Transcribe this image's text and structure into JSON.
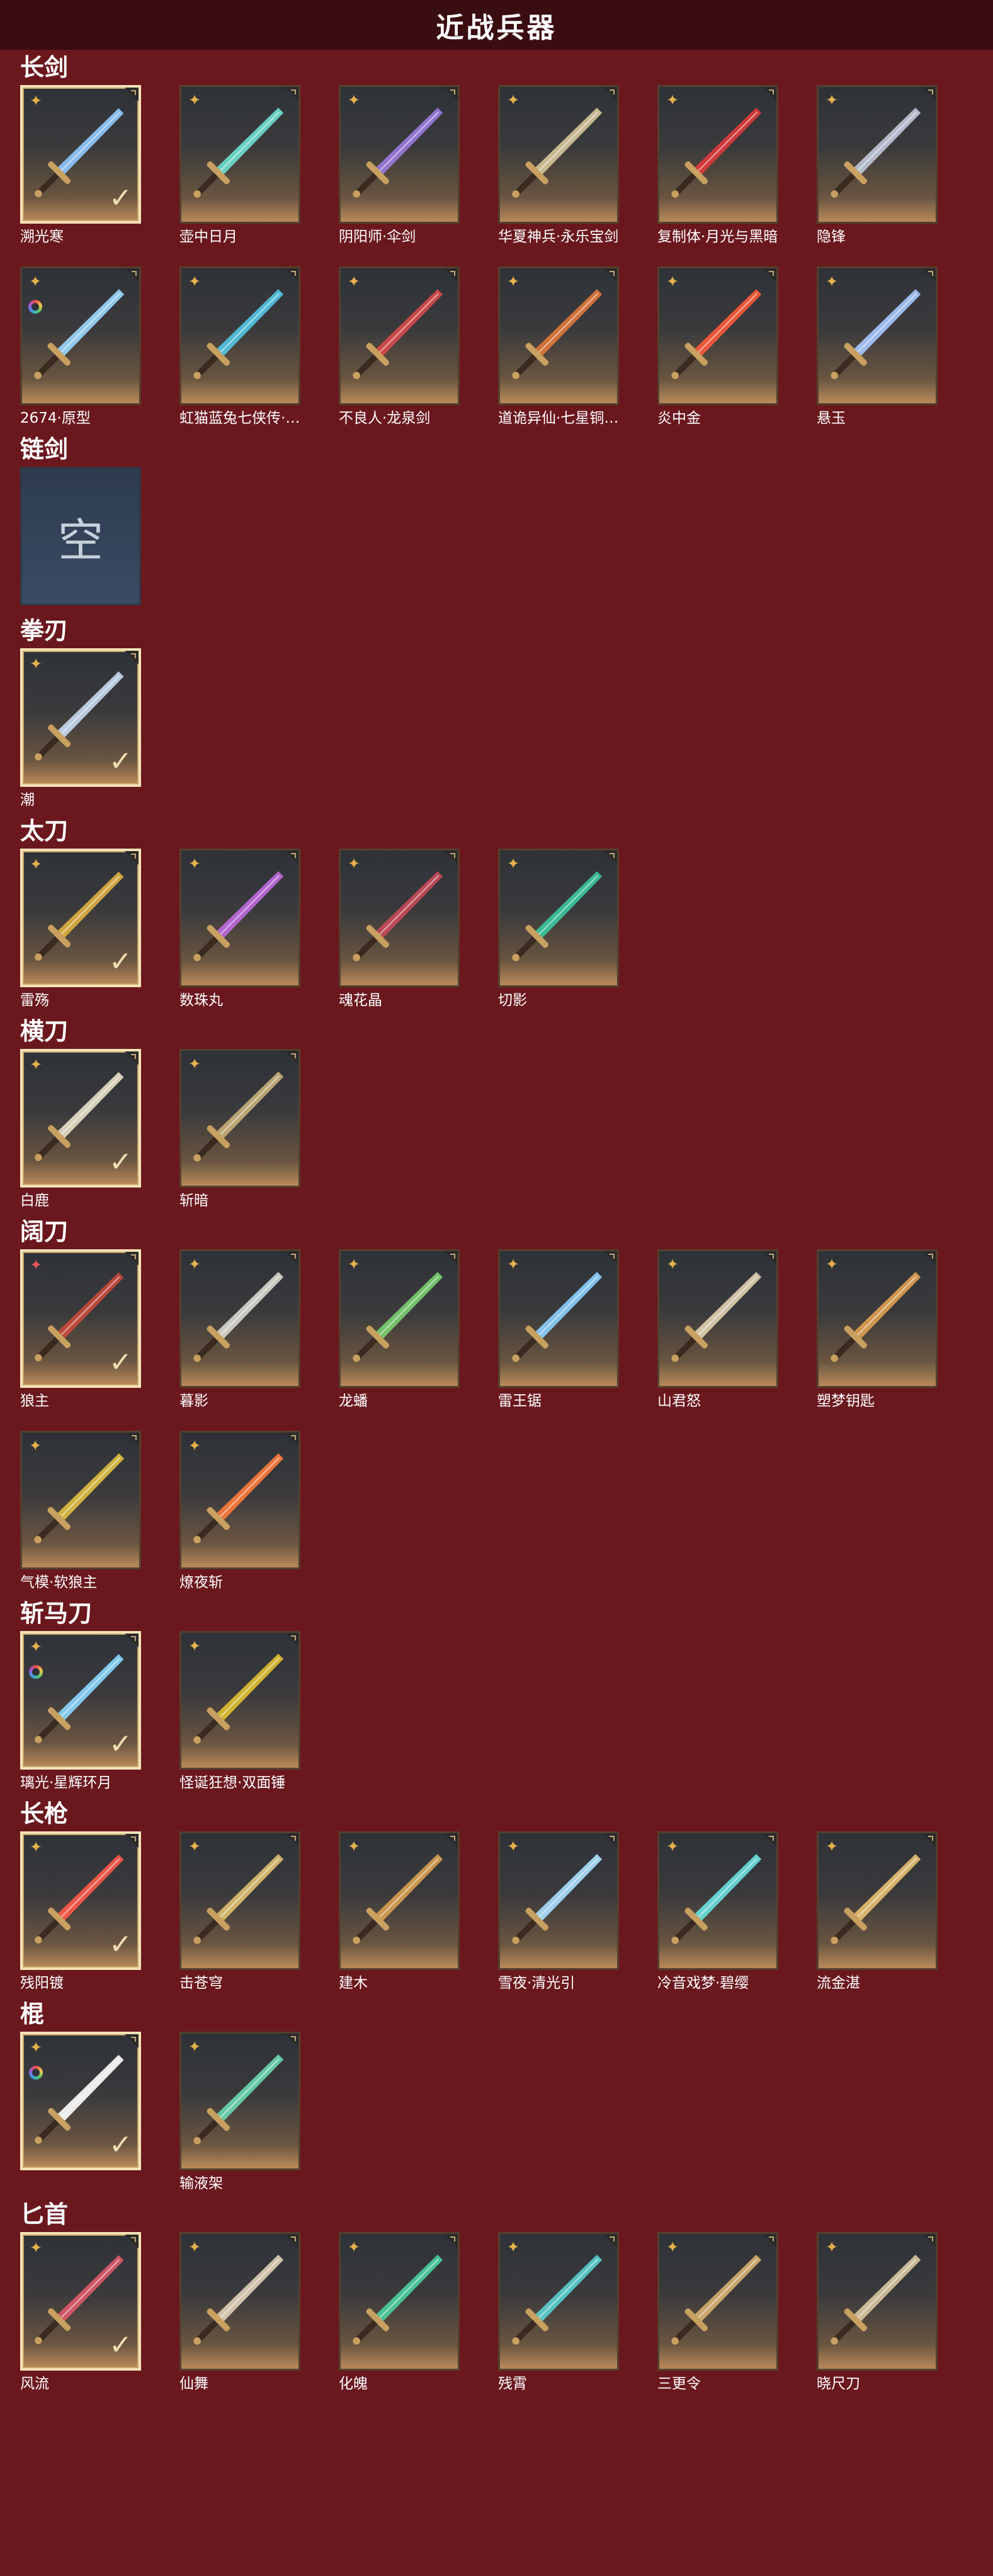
{
  "header": {
    "title": "近战兵器"
  },
  "colors": {
    "background": "#6a181e",
    "header": "#3a0d11",
    "selected_border": "#f4e3b8",
    "rarity_gold": "#e5b14a"
  },
  "sections": [
    {
      "id": "changjian",
      "title": "长剑",
      "items": [
        {
          "name": "溯光寒",
          "rarity": "gold",
          "selected": true,
          "color": "#8fc9ff"
        },
        {
          "name": "壶中日月",
          "rarity": "gold",
          "selected": false,
          "color": "#6ee0d0"
        },
        {
          "name": "阴阳师·伞剑",
          "rarity": "gold",
          "selected": false,
          "color": "#9c7be0"
        },
        {
          "name": "华夏神兵·永乐宝剑",
          "rarity": "gold",
          "selected": false,
          "color": "#d7c69a"
        },
        {
          "name": "复制体·月光与黑暗",
          "rarity": "gold",
          "selected": false,
          "color": "#e03a3a"
        },
        {
          "name": "隐锋",
          "rarity": "gold",
          "selected": false,
          "color": "#c0c8d8"
        },
        {
          "name": "2674·原型",
          "rarity": "rainbow",
          "selected": false,
          "color": "#9ad8ff"
        },
        {
          "name": "虹猫蓝兔七侠传·冰魄剑",
          "rarity": "gold",
          "selected": false,
          "color": "#52c6e6"
        },
        {
          "name": "不良人·龙泉剑",
          "rarity": "gold",
          "selected": false,
          "color": "#d84a4a"
        },
        {
          "name": "道诡异仙·七星铜钱剑",
          "rarity": "gold",
          "selected": false,
          "color": "#e0783a"
        },
        {
          "name": "炎中金",
          "rarity": "gold",
          "selected": false,
          "color": "#ff5a3a"
        },
        {
          "name": "悬玉",
          "rarity": "gold",
          "selected": false,
          "color": "#a8c8ff"
        }
      ]
    },
    {
      "id": "lianjian",
      "title": "链剑",
      "items": [
        {
          "name": "",
          "rarity": "none",
          "selected": false,
          "empty": true,
          "empty_text": "空"
        }
      ]
    },
    {
      "id": "quanren",
      "title": "拳刃",
      "items": [
        {
          "name": "潮",
          "rarity": "gold",
          "selected": true,
          "color": "#c8d8f0"
        }
      ]
    },
    {
      "id": "taidao",
      "title": "太刀",
      "items": [
        {
          "name": "雷殇",
          "rarity": "gold",
          "selected": true,
          "color": "#e0b040"
        },
        {
          "name": "数珠丸",
          "rarity": "gold",
          "selected": false,
          "color": "#c06ae0"
        },
        {
          "name": "魂花晶",
          "rarity": "gold",
          "selected": false,
          "color": "#c84a5a"
        },
        {
          "name": "切影",
          "rarity": "gold",
          "selected": false,
          "color": "#3ac8a0"
        }
      ]
    },
    {
      "id": "hengdao",
      "title": "横刀",
      "items": [
        {
          "name": "白鹿",
          "rarity": "gold",
          "selected": true,
          "color": "#e8e0c8"
        },
        {
          "name": "斩暗",
          "rarity": "gold",
          "selected": false,
          "color": "#c8b07a"
        }
      ]
    },
    {
      "id": "kuodao",
      "title": "阔刀",
      "items": [
        {
          "name": "狼主",
          "rarity": "red",
          "selected": true,
          "color": "#c84a3a"
        },
        {
          "name": "暮影",
          "rarity": "gold",
          "selected": false,
          "color": "#d8d8d0"
        },
        {
          "name": "龙蟠",
          "rarity": "gold",
          "selected": false,
          "color": "#7ad070"
        },
        {
          "name": "雷王锯",
          "rarity": "gold",
          "selected": false,
          "color": "#8ad0ff"
        },
        {
          "name": "山君怒",
          "rarity": "gold",
          "selected": false,
          "color": "#e0d0b0"
        },
        {
          "name": "塑梦钥匙",
          "rarity": "gold",
          "selected": false,
          "color": "#e0a050"
        },
        {
          "name": "气模·软狼主",
          "rarity": "gold",
          "selected": false,
          "color": "#e0c040"
        },
        {
          "name": "燎夜斩",
          "rarity": "gold",
          "selected": false,
          "color": "#ff7a3a"
        }
      ]
    },
    {
      "id": "zhanmadao",
      "title": "斩马刀",
      "items": [
        {
          "name": "璃光·星辉环月",
          "rarity": "rainbow",
          "selected": true,
          "color": "#8ad8ff"
        },
        {
          "name": "怪诞狂想·双面锤",
          "rarity": "gold",
          "selected": false,
          "color": "#e0c030"
        }
      ]
    },
    {
      "id": "changqiang",
      "title": "长枪",
      "items": [
        {
          "name": "残阳镀",
          "rarity": "gold",
          "selected": true,
          "color": "#ff5a4a"
        },
        {
          "name": "击苍穹",
          "rarity": "gold",
          "selected": false,
          "color": "#e0c070"
        },
        {
          "name": "建木",
          "rarity": "gold",
          "selected": false,
          "color": "#d8a050"
        },
        {
          "name": "雪夜·清光引",
          "rarity": "gold",
          "selected": false,
          "color": "#a8e0ff"
        },
        {
          "name": "冷音戏梦·碧缨",
          "rarity": "gold",
          "selected": false,
          "color": "#6ae0e0"
        },
        {
          "name": "流金湛",
          "rarity": "gold",
          "selected": false,
          "color": "#e8c070"
        }
      ]
    },
    {
      "id": "gun",
      "title": "棍",
      "items": [
        {
          "name": "",
          "rarity": "rainbow",
          "selected": true,
          "color": "#ffffff"
        },
        {
          "name": "输液架",
          "rarity": "gold",
          "selected": false,
          "color": "#6ad8b0"
        }
      ]
    },
    {
      "id": "bishou",
      "title": "匕首",
      "items": [
        {
          "name": "风流",
          "rarity": "gold",
          "selected": true,
          "color": "#e05a6a"
        },
        {
          "name": "仙舞",
          "rarity": "gold",
          "selected": false,
          "color": "#e0d0b8"
        },
        {
          "name": "化魄",
          "rarity": "gold",
          "selected": false,
          "color": "#4ad0a0"
        },
        {
          "name": "残霄",
          "rarity": "gold",
          "selected": false,
          "color": "#5ad0d0"
        },
        {
          "name": "三更令",
          "rarity": "gold",
          "selected": false,
          "color": "#d8b070"
        },
        {
          "name": "晓尺刀",
          "rarity": "gold",
          "selected": false,
          "color": "#d8c8a0"
        }
      ]
    }
  ]
}
